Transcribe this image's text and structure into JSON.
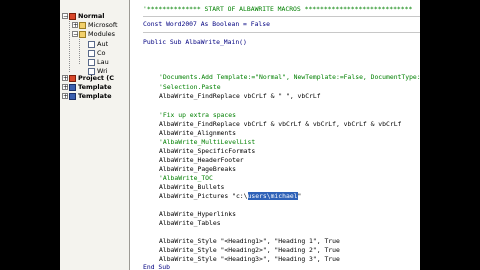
{
  "project_tree": {
    "items": [
      {
        "text": "Normal",
        "bold": true,
        "expander": "−",
        "icon": "vba-project-icon"
      },
      {
        "text": "Microsoft",
        "bold": false,
        "expander": "+",
        "icon": "folder-icon"
      },
      {
        "text": "Modules",
        "bold": false,
        "expander": "−",
        "icon": "folder-icon"
      },
      {
        "text": "Aut",
        "bold": false,
        "expander": "",
        "icon": "module-icon"
      },
      {
        "text": "Co",
        "bold": false,
        "expander": "",
        "icon": "module-icon"
      },
      {
        "text": "Lau",
        "bold": false,
        "expander": "",
        "icon": "module-icon"
      },
      {
        "text": "Wri",
        "bold": false,
        "expander": "",
        "icon": "module-icon"
      },
      {
        "text": "Project (C",
        "bold": true,
        "expander": "+",
        "icon": "vba-project-icon"
      },
      {
        "text": "Template",
        "bold": true,
        "expander": "+",
        "icon": "word-template-icon"
      },
      {
        "text": "Template",
        "bold": true,
        "expander": "+",
        "icon": "word-template-icon"
      }
    ]
  },
  "code": {
    "header_comment": "'************** START OF ALBAWRITE MACROS ****************************",
    "const_line": "Const Word2007 As Boolean = False",
    "sub_line": "Public Sub AlbaWrite_Main()",
    "lines": [
      {
        "text": "'Documents.Add Template:=\"Normal\", NewTemplate:=False, DocumentType:=0",
        "kind": "comment"
      },
      {
        "text": "'Selection.Paste",
        "kind": "comment"
      },
      {
        "text": "AlbaWrite_FindReplace vbCrLf & \" \", vbCrLf",
        "kind": "code"
      },
      {
        "text": "'Fix up extra spaces",
        "kind": "comment"
      },
      {
        "text": "AlbaWrite_FindReplace vbCrLf & vbCrLf & vbCrLf, vbCrLf & vbCrLf",
        "kind": "code"
      },
      {
        "text": "AlbaWrite_Alignments",
        "kind": "code"
      },
      {
        "text": "'AlbaWrite_MultiLevelList",
        "kind": "comment"
      },
      {
        "text": "AlbaWrite_SpecificFormats",
        "kind": "code"
      },
      {
        "text": "AlbaWrite_HeaderFooter",
        "kind": "code"
      },
      {
        "text": "AlbaWrite_PageBreaks",
        "kind": "code"
      },
      {
        "text": "'AlbaWrite_TOC",
        "kind": "comment"
      },
      {
        "text": "AlbaWrite_Bullets",
        "kind": "code"
      }
    ],
    "pictures_prefix": "AlbaWrite_Pictures \"c:\\",
    "pictures_selected": "users\\michael",
    "pictures_suffix": "\"",
    "lines_after": [
      {
        "text": "AlbaWrite_Hyperlinks",
        "kind": "code"
      },
      {
        "text": "AlbaWrite_Tables",
        "kind": "code"
      },
      {
        "text": "",
        "kind": "code"
      },
      {
        "text": "AlbaWrite_Style \"<Heading1>\", \"Heading 1\", True",
        "kind": "code"
      },
      {
        "text": "AlbaWrite_Style \"<Heading2>\", \"Heading 2\", True",
        "kind": "code"
      },
      {
        "text": "AlbaWrite_Style \"<Heading3>\", \"Heading 3\", True",
        "kind": "code"
      }
    ],
    "end_line": "End Sub"
  }
}
